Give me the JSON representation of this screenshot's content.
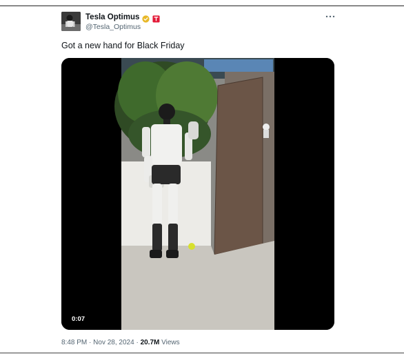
{
  "post": {
    "author_name": "Tesla Optimus",
    "author_handle": "@Tesla_Optimus",
    "text": "Got a new hand for Black Friday",
    "media": {
      "type": "video",
      "duration": "0:07"
    },
    "time": "8:48 PM",
    "separator": "·",
    "date": "Nov 28, 2024",
    "views_count": "20.7M",
    "views_label": "Views"
  },
  "icons": {
    "verified": "verified-badge-icon",
    "affiliate": "tesla-affiliate-icon",
    "more": "more-options-icon"
  },
  "colors": {
    "verified_gold": "#e8b829",
    "affiliate_red": "#e31937",
    "secondary_text": "#536471"
  }
}
